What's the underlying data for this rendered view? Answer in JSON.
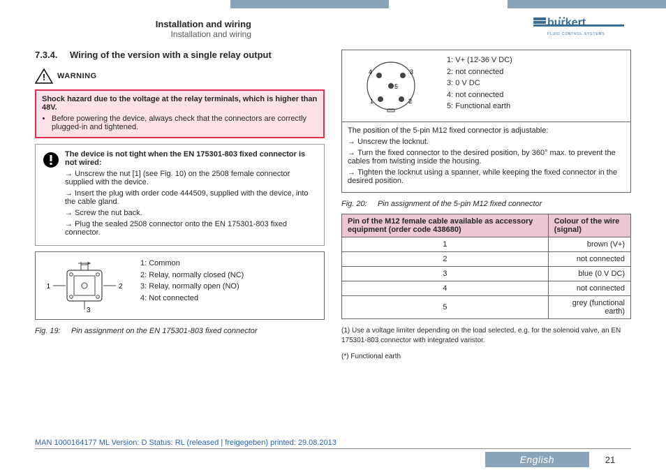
{
  "brand": {
    "name": "bürkert",
    "tagline": "FLUID CONTROL SYSTEMS"
  },
  "breadcrumb": {
    "l1": "Installation and wiring",
    "l2": "Installation and wiring"
  },
  "section": {
    "num": "7.3.4.",
    "title": "Wiring of the version with a single relay output"
  },
  "warning": {
    "label": "WARNING",
    "lead": "Shock hazard due to the voltage at the relay terminals, which is higher than 48V.",
    "bullet": "Before powering the device, always check that the connectors are correctly plugged-in and tightened."
  },
  "notice": {
    "lead": "The device is not tight when the EN 175301-803 fixed connector is not wired:",
    "items": [
      "Unscrew the nut [1] (see Fig. 10) on the 2508 female connector supplied with the device.",
      "Insert the plug with order code 444509, supplied with the device, into the cable gland.",
      "Screw the nut back.",
      "Plug the sealed 2508 connector onto the EN 175301-803 fixed connector."
    ]
  },
  "fig19": {
    "pins": {
      "p1": "1: Common",
      "p2": "2: Relay, normally closed (NC)",
      "p3": "3: Relay, normally open (NO)",
      "p4": "4: Not connected"
    },
    "caption_num": "Fig. 19:",
    "caption_text": "Pin assignment on the EN 175301-803 fixed connector",
    "labels": {
      "n1": "1",
      "n2": "2",
      "n3": "3"
    }
  },
  "fig20": {
    "pins": {
      "p1": "1: V+ (12-36 V DC)",
      "p2": "2: not connected",
      "p3": "3: 0 V DC",
      "p4": "4: not connected",
      "p5": "5: Functional earth"
    },
    "desc_lead": "The position of the 5-pin M12 fixed connector is adjustable:",
    "desc_items": [
      "Unscrew the locknut.",
      "Turn the fixed connector to the desired position, by 360° max. to prevent the cables from twisting inside the housing.",
      "Tighten the locknut using a spanner, while keeping the fixed connector in the desired position."
    ],
    "caption_num": "Fig. 20:",
    "caption_text": "Pin assignment of the 5-pin M12 fixed connector",
    "labels": {
      "n1": "1",
      "n2": "2",
      "n3": "3",
      "n4": "4",
      "n5": "5"
    }
  },
  "wire_table": {
    "head1": "Pin of the M12 female cable available as accessory equipment (order code 438680)",
    "head2": "Colour of the wire (signal)",
    "rows": [
      {
        "pin": "1",
        "colour": "brown (V+)"
      },
      {
        "pin": "2",
        "colour": "not connected"
      },
      {
        "pin": "3",
        "colour": "blue (0 V DC)"
      },
      {
        "pin": "4",
        "colour": "not connected"
      },
      {
        "pin": "5",
        "colour": "grey (functional earth)"
      }
    ]
  },
  "footnotes": {
    "f1": "(1) Use a voltage limiter depending on the load selected, e.g. for the solenoid valve, an EN 175301-803 connector with integrated varistor.",
    "f2": "(*) Functional earth"
  },
  "footer": {
    "meta": "MAN  1000164177  ML  Version: D Status: RL  (released | freigegeben)  printed: 29.08.2013",
    "language": "English",
    "page": "21"
  }
}
